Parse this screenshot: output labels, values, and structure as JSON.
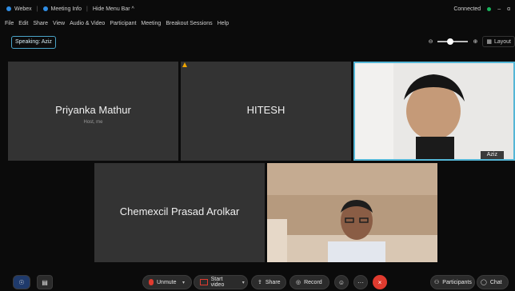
{
  "titlebar": {
    "app": "Webex",
    "meeting_info": "Meeting Info",
    "hide_menu": "Hide Menu Bar ^",
    "status": "Connected",
    "window_controls": {
      "minimize": "–",
      "close": "ɑ"
    }
  },
  "menu": [
    "File",
    "Edit",
    "Share",
    "View",
    "Audio & Video",
    "Participant",
    "Meeting",
    "Breakout Sessions",
    "Help"
  ],
  "speaking": "Speaking: Aziz",
  "layout_label": "Layout",
  "participants": {
    "priyanka": {
      "name": "Priyanka Mathur",
      "role": "Host, me"
    },
    "hitesh": {
      "name": "HITESH"
    },
    "aziz": {
      "name": "Aziz"
    },
    "chemexcil": {
      "name": "Chemexcil Prasad Arolkar"
    }
  },
  "toolbar": {
    "unmute": "Unmute",
    "start_video": "Start video",
    "share": "Share",
    "record": "Record",
    "more": "···",
    "leave": "×",
    "participants": "Participants",
    "chat": "Chat"
  },
  "colors": {
    "accent": "#54b6d6",
    "leave": "#e03b2f",
    "connected": "#19b45c",
    "warning": "#f0a500"
  }
}
